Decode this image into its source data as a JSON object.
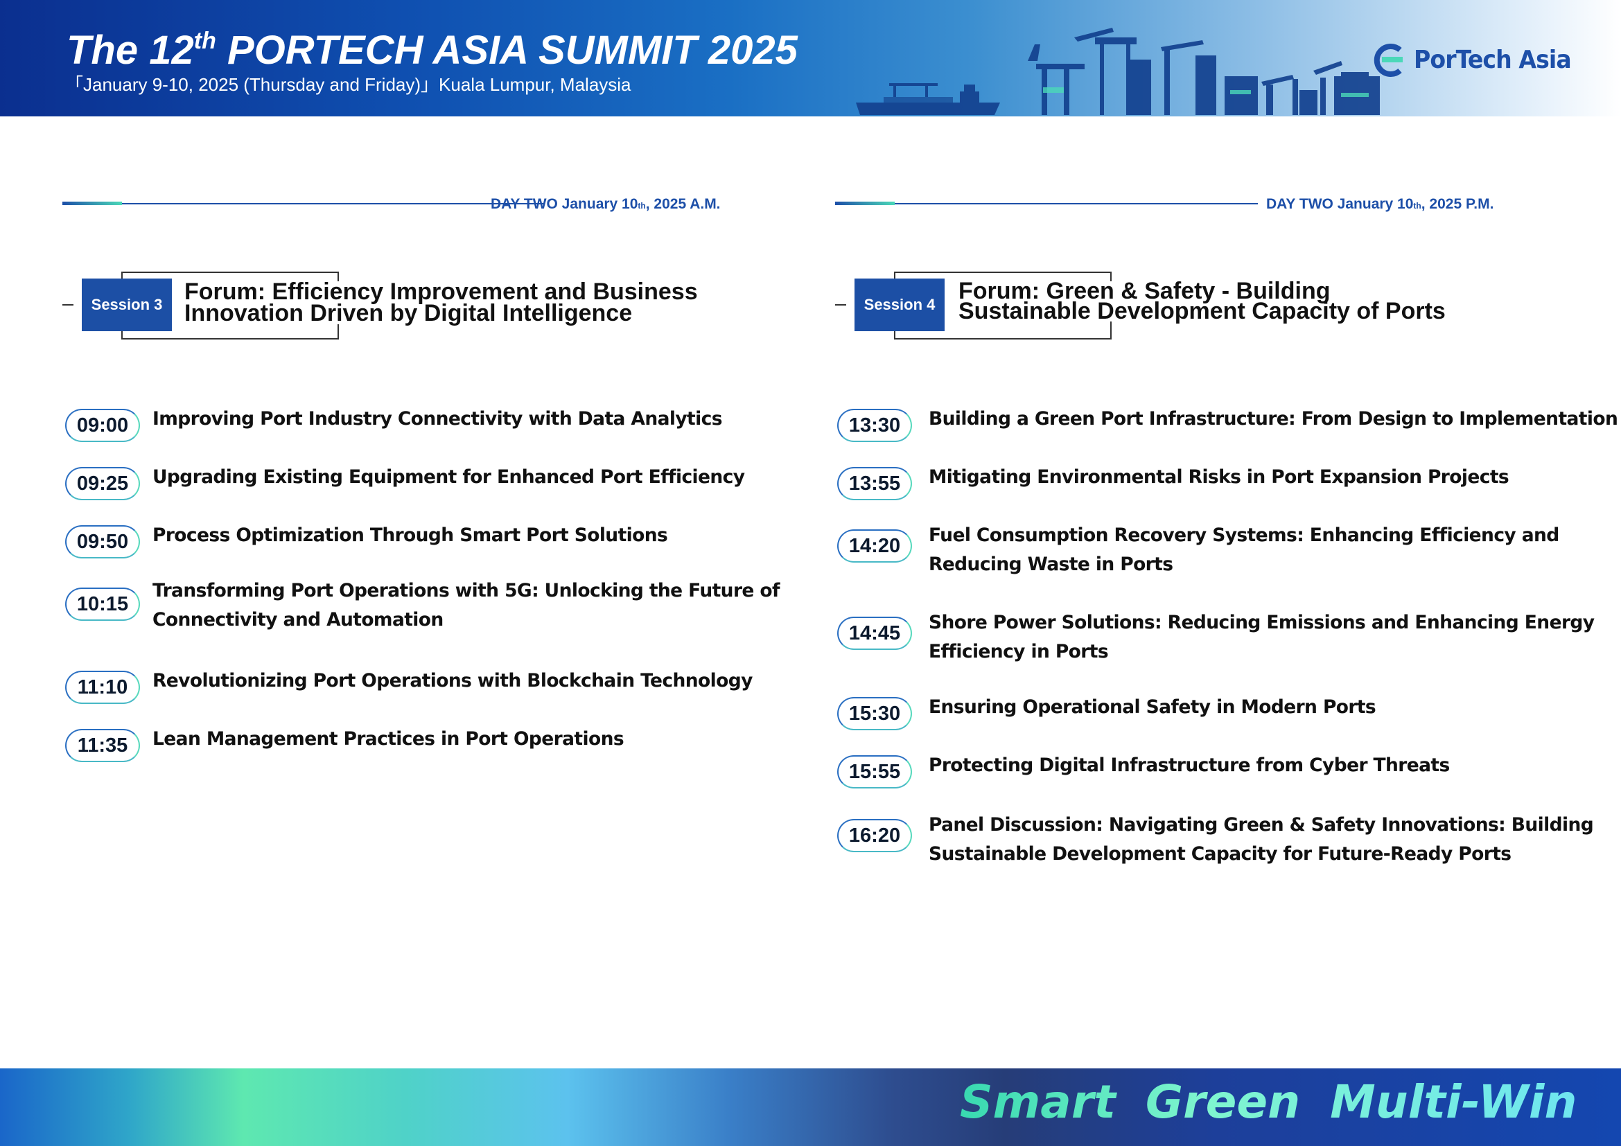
{
  "header": {
    "title_pre": "The 12",
    "title_sup": "th",
    "title_post": " PORTECH ASIA SUMMIT 2025",
    "subtitle": "「January 9-10, 2025 (Thursday and Friday)」Kuala Lumpur, Malaysia",
    "logo_text": "PorTech Asia"
  },
  "colors": {
    "brand_blue": "#1c4fa5",
    "accent_green": "#4bd8b8",
    "footer_dark": "#263d78"
  },
  "left": {
    "day_label_pre": "DAY TWO  January 10",
    "day_label_sup": "th",
    "day_label_post": ", 2025  A.M.",
    "session_tag": "Session 3",
    "forum_title_line1": "Forum: Efficiency Improvement and Business",
    "forum_title_line2": "Innovation Driven by Digital Intelligence",
    "items": [
      {
        "time": "09:00",
        "topic_line1": "Improving Port Industry Connectivity with Data Analytics",
        "topic_line2": ""
      },
      {
        "time": "09:25",
        "topic_line1": "Upgrading Existing Equipment for Enhanced Port Efficiency",
        "topic_line2": ""
      },
      {
        "time": "09:50",
        "topic_line1": "Process Optimization Through Smart Port Solutions",
        "topic_line2": ""
      },
      {
        "time": "10:15",
        "topic_line1": "Transforming Port Operations with 5G: Unlocking the Future of",
        "topic_line2": "Connectivity and Automation"
      },
      {
        "time": "11:10",
        "topic_line1": "Revolutionizing Port Operations with Blockchain Technology",
        "topic_line2": ""
      },
      {
        "time": "11:35",
        "topic_line1": "Lean Management Practices in Port Operations",
        "topic_line2": ""
      }
    ]
  },
  "right": {
    "day_label_pre": "DAY TWO  January 10",
    "day_label_sup": "th",
    "day_label_post": ", 2025  P.M.",
    "session_tag": "Session 4",
    "forum_title_line1": "Forum: Green & Safety - Building",
    "forum_title_line2": "Sustainable Development Capacity of Ports",
    "items": [
      {
        "time": "13:30",
        "topic_line1": "Building a Green Port Infrastructure: From Design to Implementation",
        "topic_line2": ""
      },
      {
        "time": "13:55",
        "topic_line1": "Mitigating Environmental Risks in Port Expansion Projects",
        "topic_line2": ""
      },
      {
        "time": "14:20",
        "topic_line1": "Fuel Consumption Recovery Systems: Enhancing Efficiency and",
        "topic_line2": "Reducing Waste in Ports"
      },
      {
        "time": "14:45",
        "topic_line1": "Shore Power Solutions: Reducing Emissions and Enhancing Energy",
        "topic_line2": "Efficiency in Ports"
      },
      {
        "time": "15:30",
        "topic_line1": "Ensuring Operational Safety in Modern Ports",
        "topic_line2": ""
      },
      {
        "time": "15:55",
        "topic_line1": "Protecting Digital Infrastructure from Cyber Threats",
        "topic_line2": ""
      },
      {
        "time": "16:20",
        "topic_line1": "Panel Discussion: Navigating Green & Safety Innovations: Building",
        "topic_line2": "Sustainable Development Capacity for Future-Ready Ports"
      }
    ]
  },
  "footer": {
    "slogan": "Smart  Green  Multi-Win"
  }
}
